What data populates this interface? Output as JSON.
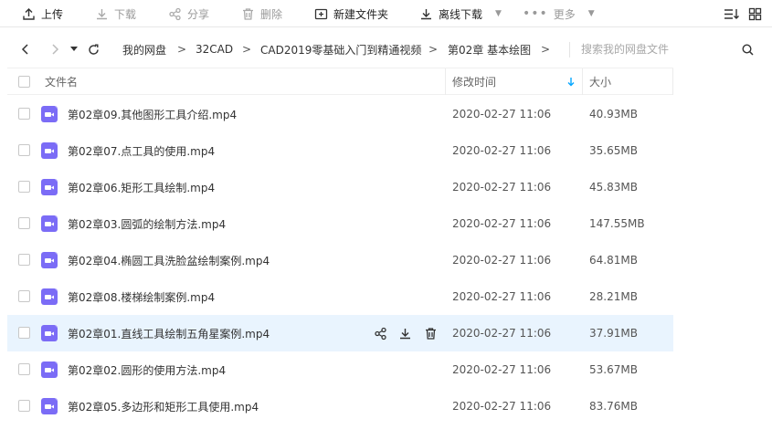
{
  "toolbar": {
    "upload": "上传",
    "download": "下载",
    "share": "分享",
    "delete": "删除",
    "new_folder": "新建文件夹",
    "offline_download": "离线下载",
    "more": "更多"
  },
  "breadcrumb": [
    "我的网盘",
    "32CAD",
    "CAD2019零基础入门到精通视频",
    "第02章 基本绘图"
  ],
  "breadcrumb_separator": ">",
  "search": {
    "placeholder": "搜索我的网盘文件"
  },
  "columns": {
    "name": "文件名",
    "modified": "修改时间",
    "size": "大小"
  },
  "files": [
    {
      "name": "第02章09.其他图形工具介绍.mp4",
      "modified": "2020-02-27 11:06",
      "size": "40.93MB"
    },
    {
      "name": "第02章07.点工具的使用.mp4",
      "modified": "2020-02-27 11:06",
      "size": "35.65MB"
    },
    {
      "name": "第02章06.矩形工具绘制.mp4",
      "modified": "2020-02-27 11:06",
      "size": "45.83MB"
    },
    {
      "name": "第02章03.圆弧的绘制方法.mp4",
      "modified": "2020-02-27 11:06",
      "size": "147.55MB"
    },
    {
      "name": "第02章04.椭圆工具洗脸盆绘制案例.mp4",
      "modified": "2020-02-27 11:06",
      "size": "64.81MB"
    },
    {
      "name": "第02章08.楼梯绘制案例.mp4",
      "modified": "2020-02-27 11:06",
      "size": "28.21MB"
    },
    {
      "name": "第02章01.直线工具绘制五角星案例.mp4",
      "modified": "2020-02-27 11:06",
      "size": "37.91MB"
    },
    {
      "name": "第02章02.圆形的使用方法.mp4",
      "modified": "2020-02-27 11:06",
      "size": "53.67MB"
    },
    {
      "name": "第02章05.多边形和矩形工具使用.mp4",
      "modified": "2020-02-27 11:06",
      "size": "83.76MB"
    }
  ],
  "hovered_row": 6,
  "colors": {
    "accent": "#06a7ff",
    "video_icon": "#7b6cf6",
    "row_hover": "#e9f4fe"
  }
}
